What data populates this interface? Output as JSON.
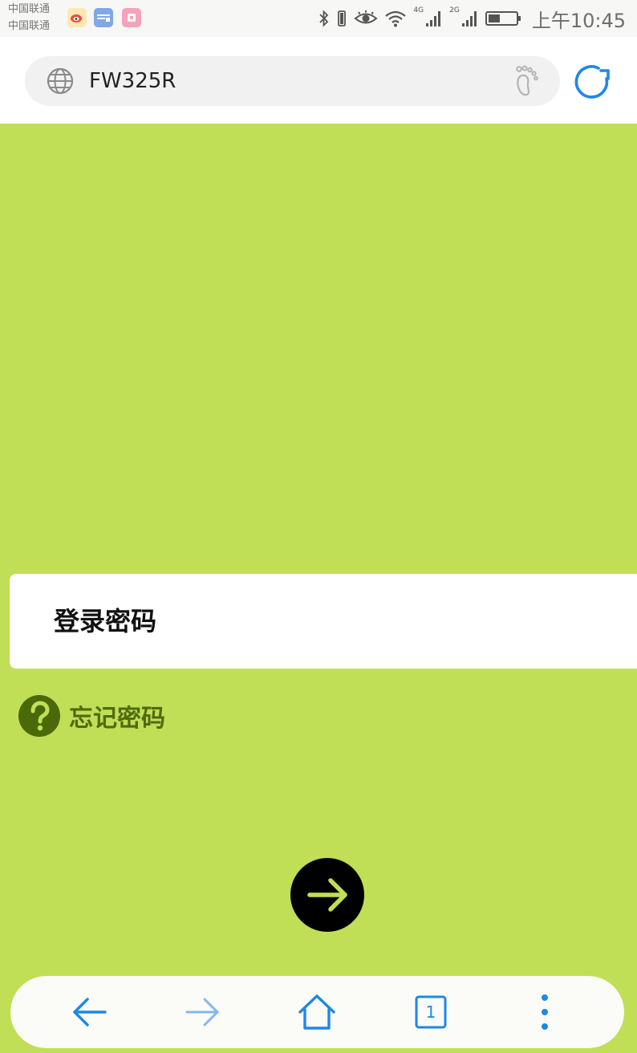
{
  "status_bar": {
    "carrier_1": "中国联通",
    "carrier_2": "中国联通",
    "network_1": "4G",
    "network_2": "2G",
    "time": "上午10:45",
    "icons": [
      "weibo-icon",
      "news-icon",
      "app-icon",
      "bluetooth-icon",
      "vibrate-icon",
      "eye-icon",
      "wifi-icon",
      "signal-icon",
      "battery-icon"
    ]
  },
  "address_bar": {
    "url": "FW325R",
    "icons": [
      "globe-icon",
      "footprint-icon",
      "refresh-icon"
    ]
  },
  "login": {
    "password_label": "登录密码",
    "forgot_password": "忘记密码"
  },
  "bottom_nav": {
    "tab_count": "1",
    "icons": [
      "back-arrow-icon",
      "forward-arrow-icon",
      "home-icon",
      "tabs-icon",
      "more-menu-icon"
    ]
  },
  "colors": {
    "page_background": "#c0df56",
    "accent_blue": "#1e88e5",
    "forgot_link": "#4f6b0c",
    "help_icon": "#4a6a0a"
  }
}
